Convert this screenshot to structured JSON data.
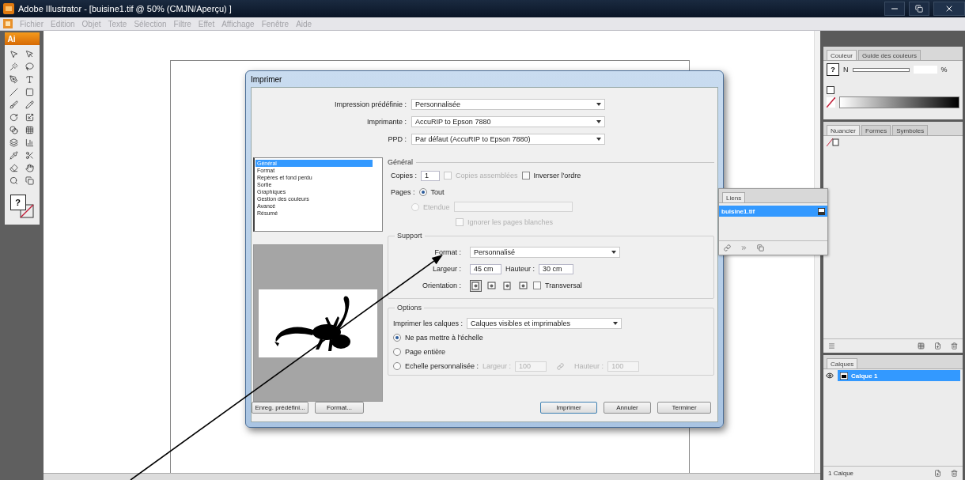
{
  "window": {
    "title": "Adobe Illustrator - [buisine1.tif @ 50% (CMJN/Aperçu) ]"
  },
  "menu": [
    "Fichier",
    "Edition",
    "Objet",
    "Texte",
    "Sélection",
    "Filtre",
    "Effet",
    "Affichage",
    "Fenêtre",
    "Aide"
  ],
  "toolbar": {
    "badge": "Ai",
    "fill_glyph": "?"
  },
  "dialog": {
    "title": "Imprimer",
    "presets": [
      {
        "label": "Impression prédéfinie :",
        "value": "Personnalisée"
      },
      {
        "label": "Imprimante :",
        "value": "AccuRIP to Epson 7880"
      },
      {
        "label": "PPD :",
        "value": "Par défaut (AccuRIP to Epson 7880)"
      }
    ],
    "categories": [
      {
        "label": "Général",
        "selected": true
      },
      {
        "label": "Format",
        "selected": false
      },
      {
        "label": "Repères et fond perdu",
        "selected": false
      },
      {
        "label": "Sortie",
        "selected": false
      },
      {
        "label": "Graphiques",
        "selected": false
      },
      {
        "label": "Gestion des couleurs",
        "selected": false
      },
      {
        "label": "Avancé",
        "selected": false
      },
      {
        "label": "Résumé",
        "selected": false
      }
    ],
    "section_title": "Général",
    "copies": {
      "label": "Copies :",
      "value": "1"
    },
    "copy_checkboxes": [
      {
        "label": "Copies assemblées",
        "checked": false,
        "disabled": true
      },
      {
        "label": "Inverser l'ordre",
        "checked": false,
        "disabled": false
      }
    ],
    "pages_label": "Pages :",
    "pages": [
      {
        "label": "Tout",
        "selected": true,
        "disabled": false
      },
      {
        "label": "Etendue",
        "selected": false,
        "disabled": true
      }
    ],
    "ignore_blank": {
      "label": "Ignorer les pages blanches",
      "checked": false,
      "disabled": true
    },
    "support": {
      "title": "Support",
      "format_label": "Format :",
      "format_value": "Personnalisé",
      "width_label": "Largeur :",
      "width_value": "45 cm",
      "height_label": "Hauteur :",
      "height_value": "30 cm",
      "orientation_label": "Orientation :",
      "orientations": [
        {
          "selected": true
        },
        {
          "selected": false
        },
        {
          "selected": false
        },
        {
          "selected": false
        }
      ],
      "transverse": {
        "label": "Transversal",
        "checked": false
      }
    },
    "options": {
      "title": "Options",
      "layers_label": "Imprimer les calques :",
      "layers_value": "Calques visibles et imprimables",
      "scaling": [
        {
          "kind": "plain",
          "label": "Ne pas mettre à l'échelle",
          "selected": true
        },
        {
          "kind": "plain",
          "label": "Page entière",
          "selected": false
        },
        {
          "kind": "custom",
          "label": "Echelle personnalisée :",
          "selected": false
        }
      ],
      "custom_width_label": "Largeur :",
      "custom_width_value": "100",
      "custom_height_label": "Hauteur :",
      "custom_height_value": "100"
    },
    "left_buttons": [
      {
        "label": "Enreg. prédéfini..."
      },
      {
        "label": "Format..."
      }
    ],
    "right_buttons": [
      {
        "label": "Imprimer",
        "default": true
      },
      {
        "label": "Annuler",
        "default": false
      },
      {
        "label": "Terminer",
        "default": false
      }
    ]
  },
  "links_panel": {
    "tab": "Liens",
    "items": [
      {
        "label": "buisine1.tif",
        "selected": true
      }
    ]
  },
  "color_panel": {
    "tabs": [
      {
        "label": "Couleur",
        "selected": true
      },
      {
        "label": "Guide des couleurs",
        "selected": false
      }
    ],
    "fill_glyph": "?",
    "channel": "N",
    "unit": "%"
  },
  "swatches_panel": {
    "tabs": [
      {
        "label": "Nuancier",
        "selected": true
      },
      {
        "label": "Formes",
        "selected": false
      },
      {
        "label": "Symboles",
        "selected": false
      }
    ]
  },
  "layers_panel": {
    "tab": "Calques",
    "layers": [
      {
        "name": "Calque 1",
        "selected": true
      }
    ],
    "count": "1 Calque"
  }
}
